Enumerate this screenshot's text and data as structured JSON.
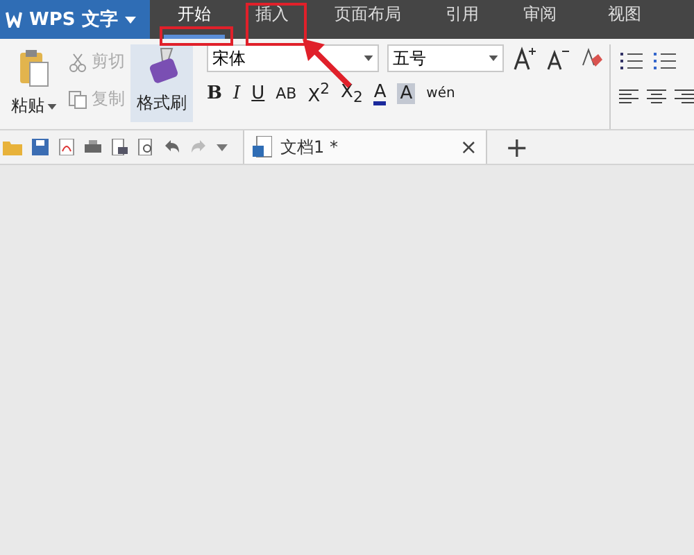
{
  "app_menu": {
    "label": "WPS 文字"
  },
  "tabs": [
    {
      "label": "开始",
      "selected": true
    },
    {
      "label": "插入",
      "selected": false
    },
    {
      "label": "页面布局",
      "selected": false
    },
    {
      "label": "引用",
      "selected": false
    },
    {
      "label": "审阅",
      "selected": false
    },
    {
      "label": "视图",
      "selected": false
    }
  ],
  "clipboard": {
    "paste": "粘贴",
    "small": [
      {
        "label": "剪切",
        "kind": "cut",
        "disabled": true
      },
      {
        "label": "复制",
        "kind": "copy",
        "disabled": true
      }
    ],
    "format_painter": {
      "label": "格式刷",
      "selected": true
    }
  },
  "font": {
    "name": "宋体",
    "size": "五号"
  },
  "format_buttons": [
    {
      "label": "B",
      "kind": "bold"
    },
    {
      "label": "I",
      "kind": "italic"
    },
    {
      "label": "U",
      "kind": "underline"
    },
    {
      "label": "AB",
      "kind": "strike"
    },
    {
      "label": "X$^{2}$",
      "kind": "super"
    },
    {
      "label": "X$_{2}$",
      "kind": "sub"
    },
    {
      "label": "A",
      "kind": "color"
    },
    {
      "label": "A",
      "kind": "shade"
    },
    {
      "label": "wén",
      "kind": "pinyin"
    }
  ],
  "document_tab": {
    "title": "文档1 *",
    "close": "×"
  },
  "new_tab": "+"
}
